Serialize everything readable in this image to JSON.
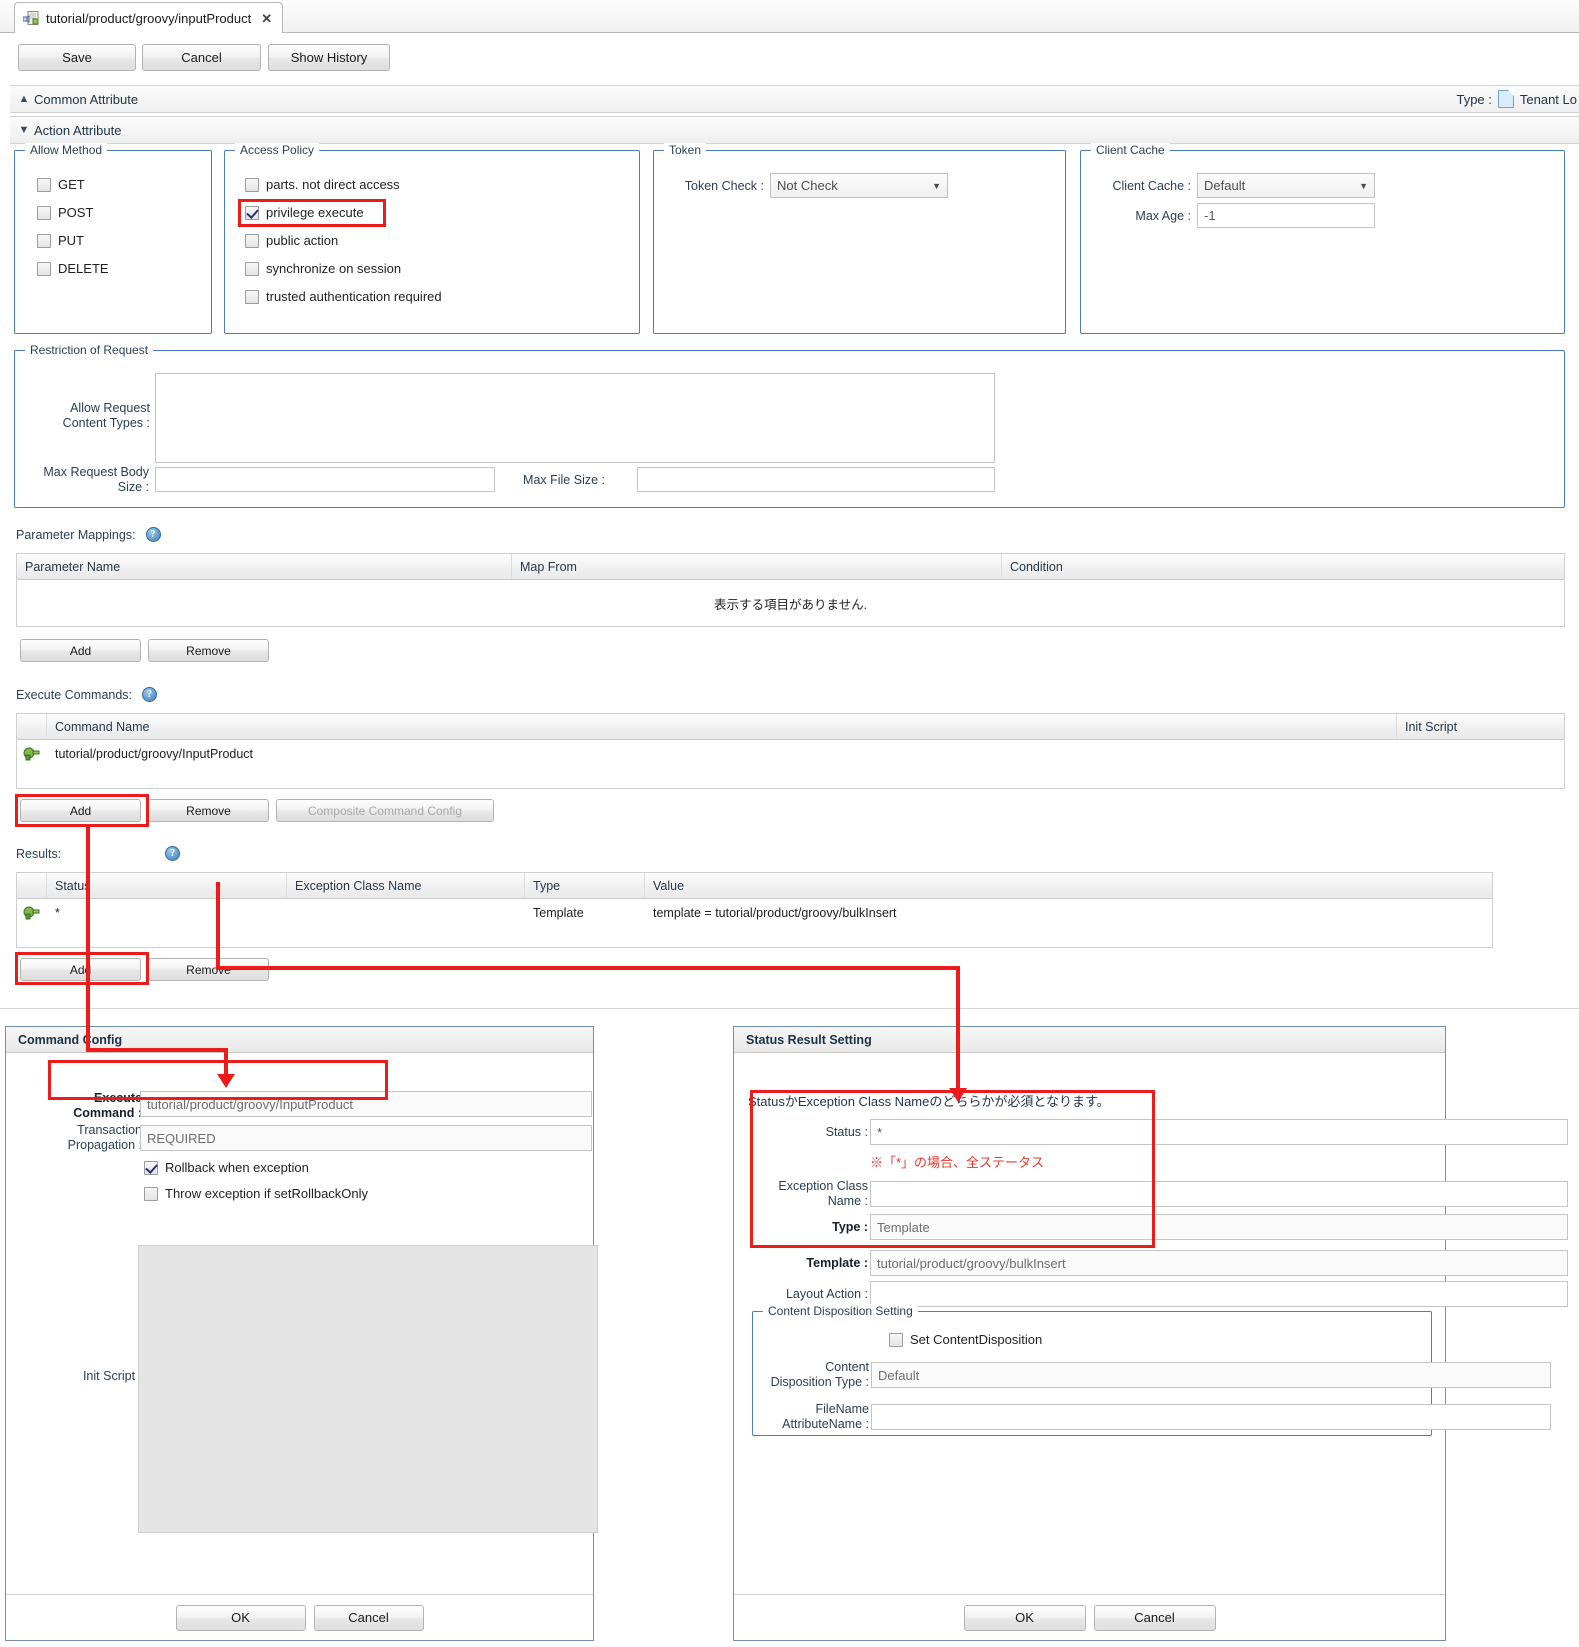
{
  "tab": {
    "title": "tutorial/product/groovy/inputProduct",
    "close": "✕",
    "icon": "script-file-icon"
  },
  "toolbar": {
    "save": "Save",
    "cancel": "Cancel",
    "show_history": "Show History"
  },
  "sections": {
    "common_attribute": "Common Attribute",
    "action_attribute": "Action Attribute",
    "type_label": "Type :",
    "type_value": "Tenant Lo"
  },
  "allow_method": {
    "legend": "Allow Method",
    "items": [
      {
        "label": "GET",
        "checked": false
      },
      {
        "label": "POST",
        "checked": false
      },
      {
        "label": "PUT",
        "checked": false
      },
      {
        "label": "DELETE",
        "checked": false
      }
    ]
  },
  "access_policy": {
    "legend": "Access Policy",
    "items": [
      {
        "label": "parts. not direct access",
        "checked": false
      },
      {
        "label": "privilege execute",
        "checked": true
      },
      {
        "label": "public action",
        "checked": false
      },
      {
        "label": "synchronize on session",
        "checked": false
      },
      {
        "label": "trusted authentication required",
        "checked": false
      }
    ]
  },
  "token": {
    "legend": "Token",
    "check_label": "Token Check :",
    "check_value": "Not Check"
  },
  "client_cache": {
    "legend": "Client Cache",
    "cache_label": "Client Cache :",
    "cache_value": "Default",
    "max_age_label": "Max Age :",
    "max_age_value": "-1"
  },
  "restriction": {
    "legend": "Restriction of Request",
    "content_types_label_line1": "Allow Request",
    "content_types_label_line2": "Content Types :",
    "content_types_value": "",
    "max_body_label_line1": "Max Request Body",
    "max_body_label_line2": "Size :",
    "max_body_value": "",
    "max_file_label": "Max File Size :",
    "max_file_value": ""
  },
  "parameter_mappings": {
    "caption": "Parameter Mappings:",
    "help": "?",
    "columns": [
      "Parameter Name",
      "Map From",
      "Condition"
    ],
    "empty_text": "表示する項目がありません.",
    "add": "Add",
    "remove": "Remove"
  },
  "execute_commands": {
    "caption": "Execute Commands:",
    "help": "?",
    "columns": [
      "Command Name",
      "Init Script"
    ],
    "rows": [
      {
        "name": "tutorial/product/groovy/InputProduct",
        "init_script": ""
      }
    ],
    "add": "Add",
    "remove": "Remove",
    "composite": "Composite Command Config"
  },
  "results": {
    "caption": "Results:",
    "help": "?",
    "columns": [
      "Status",
      "Exception Class Name",
      "Type",
      "Value"
    ],
    "rows": [
      {
        "status": "*",
        "exception_class": "",
        "type": "Template",
        "value": "template = tutorial/product/groovy/bulkInsert"
      }
    ],
    "add": "Add",
    "remove": "Remove"
  },
  "command_config": {
    "title": "Command Config",
    "execute_command_label_line1": "Execute",
    "execute_command_label_line2": "Command :",
    "execute_command_value": "tutorial/product/groovy/InputProduct",
    "transaction_label_line1": "Transaction",
    "transaction_label_line2": "Propagation :",
    "transaction_value": "REQUIRED",
    "rollback_label": "Rollback when exception",
    "rollback_checked": true,
    "throw_label": "Throw exception if setRollbackOnly",
    "throw_checked": false,
    "init_script_label": "Init Script :",
    "init_script_value": "",
    "ok": "OK",
    "cancel": "Cancel"
  },
  "status_result_setting": {
    "title": "Status Result Setting",
    "note": "StatusかException Class Nameのどちらかが必須となります。",
    "status_label": "Status :",
    "status_value": "*",
    "status_hint": "※「*」の場合、全ステータス",
    "exception_label_line1": "Exception Class",
    "exception_label_line2": "Name :",
    "exception_value": "",
    "type_label": "Type :",
    "type_value": "Template",
    "template_label": "Template :",
    "template_value": "tutorial/product/groovy/bulkInsert",
    "layout_action_label": "Layout Action :",
    "layout_action_value": "",
    "content_disposition": {
      "legend": "Content Disposition Setting",
      "set_label": "Set ContentDisposition",
      "set_checked": false,
      "type_label_line1": "Content",
      "type_label_line2": "Disposition Type :",
      "type_value": "Default",
      "filename_label_line1": "FileName",
      "filename_label_line2": "AttributeName :",
      "filename_value": ""
    },
    "ok": "OK",
    "cancel": "Cancel"
  },
  "colors": {
    "accent": "#4a7ebb",
    "highlight": "#ee1b1b",
    "note": "#e8382d"
  }
}
